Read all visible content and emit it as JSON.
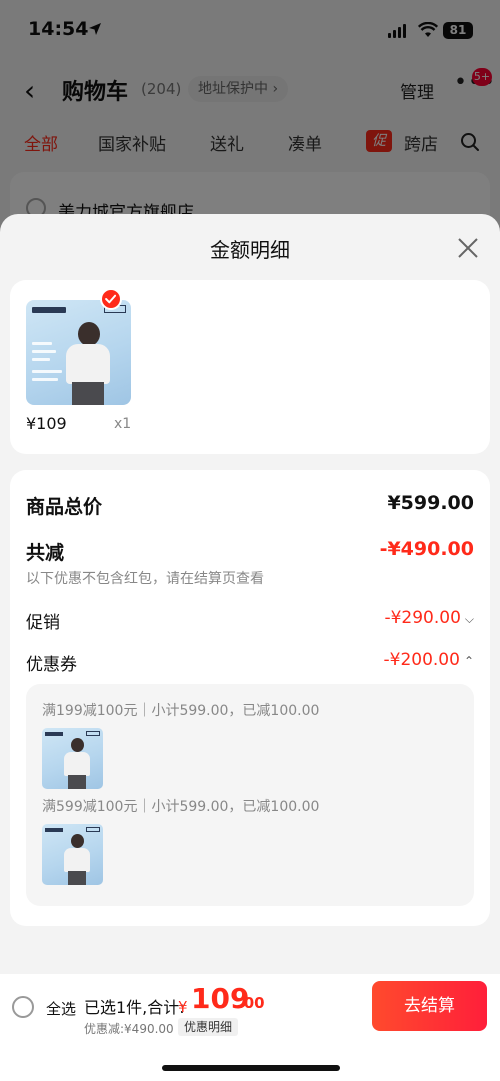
{
  "status": {
    "time": "14:54",
    "battery": "81"
  },
  "nav": {
    "title": "购物车",
    "count": "(204)",
    "address_pill": "地址保护中",
    "manage": "管理",
    "more_badge": "5+"
  },
  "tabs": [
    "全部",
    "国家补贴",
    "送礼",
    "凑单",
    "跨店"
  ],
  "promo_tag": "促",
  "store": {
    "name": "美力城官方旗舰店"
  },
  "sheet": {
    "title": "金额明细",
    "product": {
      "price": "¥109",
      "qty": "x1"
    },
    "summary": {
      "total_label": "商品总价",
      "total_value": "¥599.00",
      "discount_label": "共减",
      "discount_value": "-¥490.00",
      "note": "以下优惠不包含红包，请在结算页查看",
      "promo_label": "促销",
      "promo_value": "-¥290.00",
      "coupon_label": "优惠券",
      "coupon_value": "-¥200.00"
    },
    "coupons": [
      {
        "text": "满199减100元｜小计599.00，已减100.00"
      },
      {
        "text": "满599减100元｜小计599.00，已减100.00"
      }
    ]
  },
  "checkout": {
    "select_all": "全选",
    "selected": "已选1件,合计:",
    "currency": "¥",
    "total_int": "109",
    "total_dec": ".00",
    "discount": "优惠减:¥490.00",
    "detail_button": "优惠明细",
    "checkout_button": "去结算"
  },
  "colors": {
    "accent": "#ff2a1a",
    "sheet_bg": "#f3f3f3"
  }
}
